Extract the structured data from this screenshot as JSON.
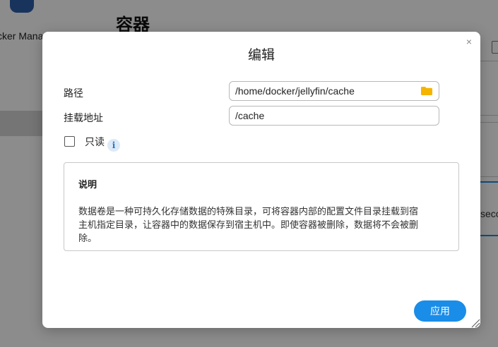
{
  "background": {
    "app_name": "cker Mana",
    "page_title": "容器",
    "right_peek_text": "seco"
  },
  "dialog": {
    "title": "编辑",
    "close_label": "×",
    "path": {
      "label": "路径",
      "value": "/home/docker/jellyfin/cache",
      "icon": "folder-icon"
    },
    "mount": {
      "label": "挂载地址",
      "value": "/cache"
    },
    "readonly": {
      "label": "只读",
      "checked": false,
      "info_icon": "i"
    },
    "note": {
      "title": "说明",
      "body_line1": "数据卷是一种可持久化存储数据的特殊目录，可将容器内部的配置文件目录挂载到宿",
      "body_line2": "主机指定目录，让容器中的数据保存到宿主机中。即使容器被删除，数据将不会被删",
      "body_line3": "除。"
    },
    "apply_label": "应用"
  },
  "colors": {
    "accent": "#1a8de8",
    "folder": "#f5b400",
    "overlay": "rgba(0,0,0,0.45)"
  }
}
